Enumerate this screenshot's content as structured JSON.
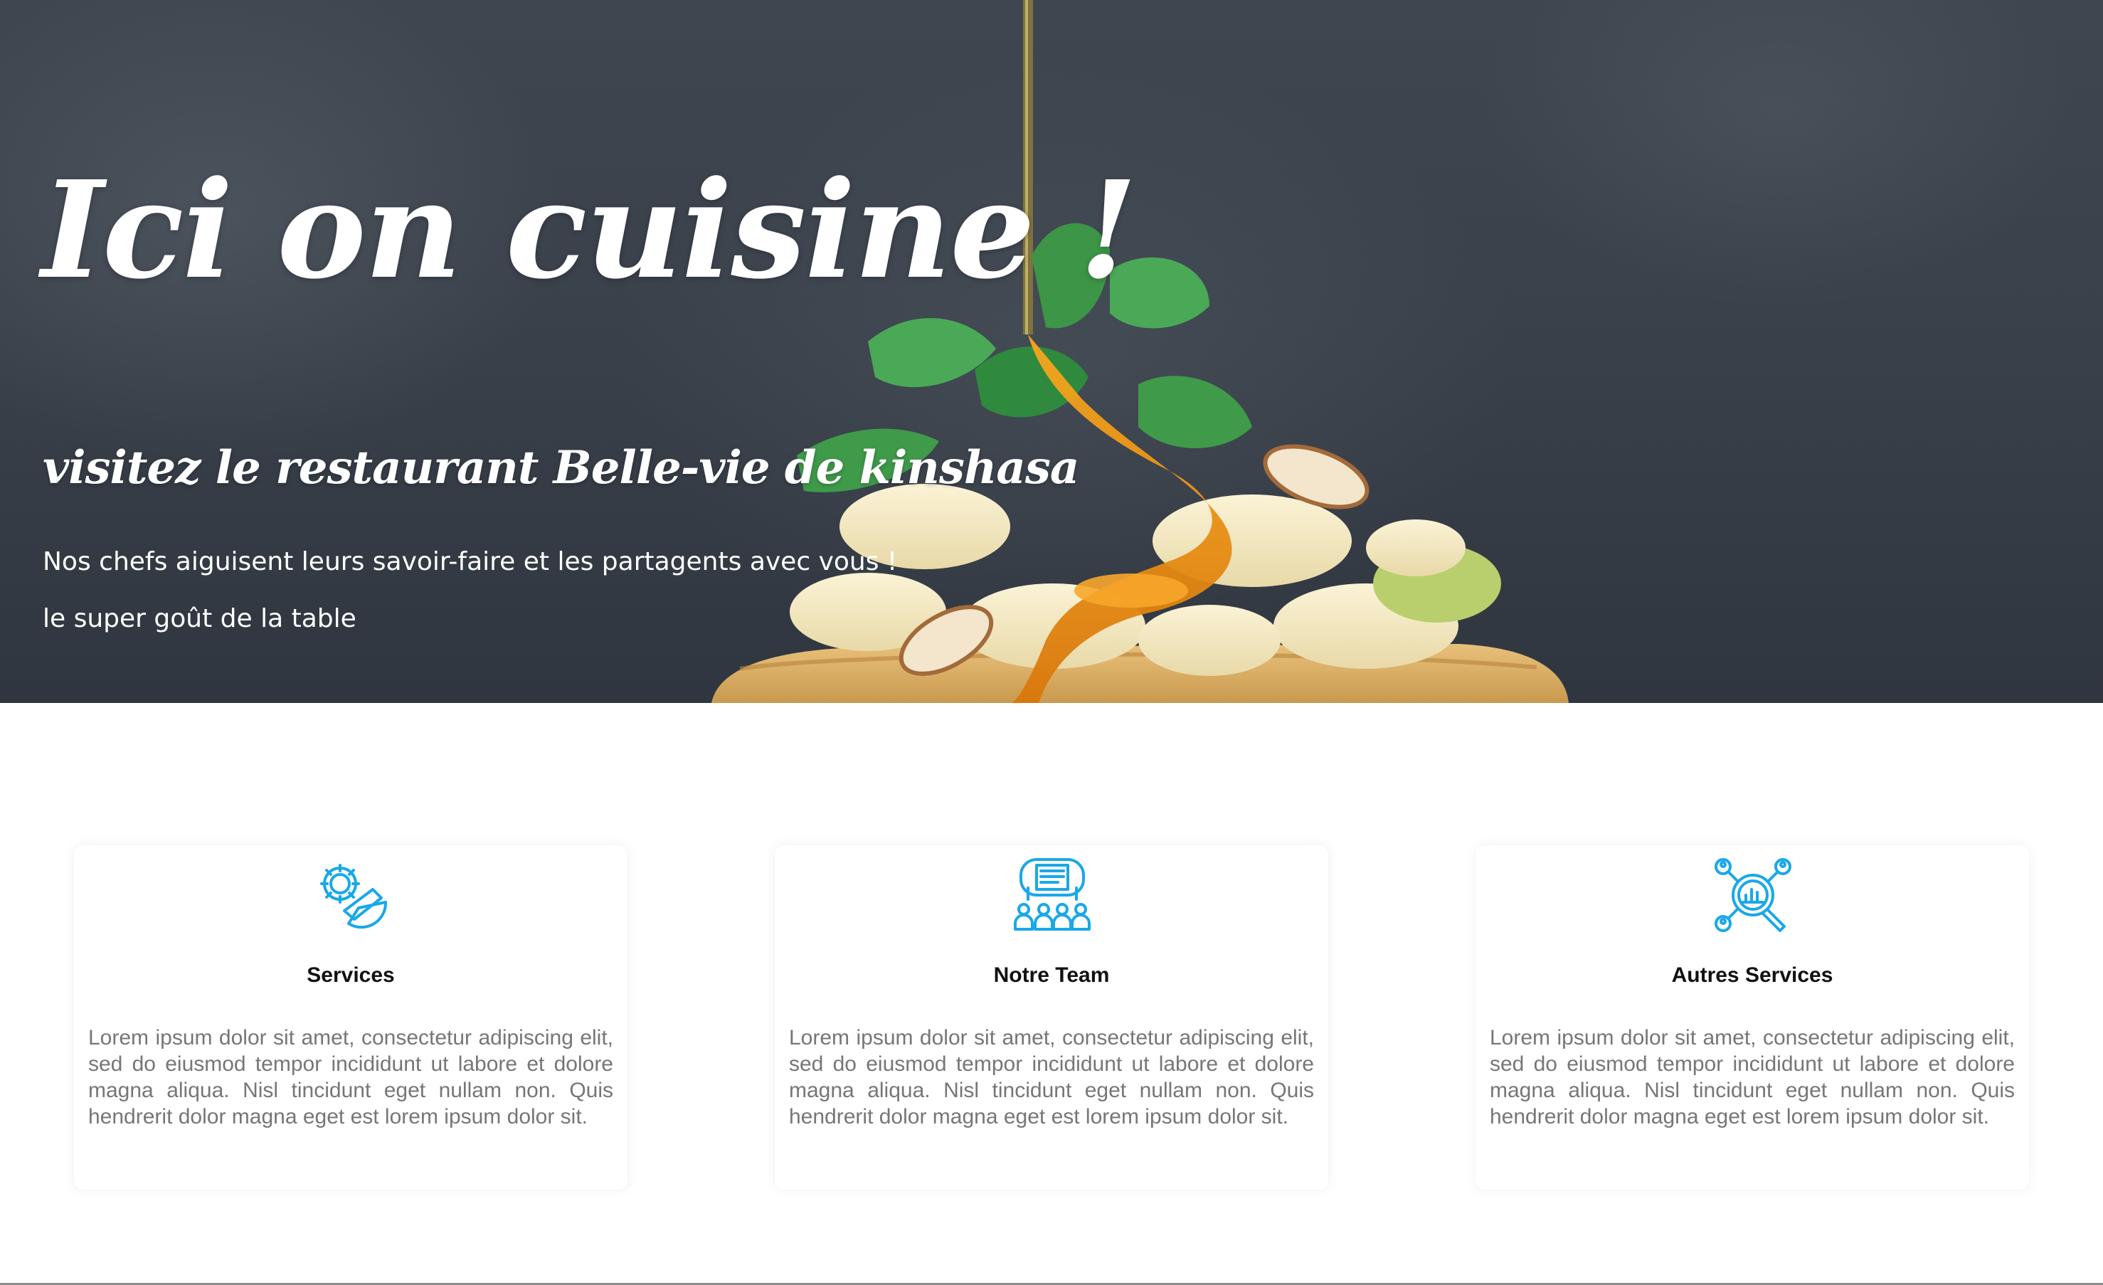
{
  "hero": {
    "title": "Ici on cuisine !",
    "subtitle": "visitez le restaurant Belle-vie de kinshasa",
    "lines": [
      "Nos chefs aiguisent leurs savoir-faire et les partagents avec vous !",
      "le super goût de la table"
    ],
    "image": "pancakes-banana-honey-photo"
  },
  "features": {
    "accent_color": "#1aa8e8",
    "cards": [
      {
        "icon": "gear-wrench-icon",
        "title": "Services",
        "text": "Lorem ipsum dolor sit amet, consectetur adipiscing elit, sed do eiusmod tempor incididunt ut labore et dolore magna aliqua. Nisl tincidunt eget nullam non. Quis hendrerit dolor magna eget est lorem ipsum dolor sit."
      },
      {
        "icon": "team-presentation-icon",
        "title": "Notre Team",
        "text": "Lorem ipsum dolor sit amet, consectetur adipiscing elit, sed do eiusmod tempor incididunt ut labore et dolore magna aliqua. Nisl tincidunt eget nullam non. Quis hendrerit dolor magna eget est lorem ipsum dolor sit."
      },
      {
        "icon": "analytics-search-users-icon",
        "title": "Autres Services",
        "text": "Lorem ipsum dolor sit amet, consectetur adipiscing elit, sed do eiusmod tempor incididunt ut labore et dolore magna aliqua. Nisl tincidunt eget nullam non. Quis hendrerit dolor magna eget est lorem ipsum dolor sit."
      }
    ]
  }
}
